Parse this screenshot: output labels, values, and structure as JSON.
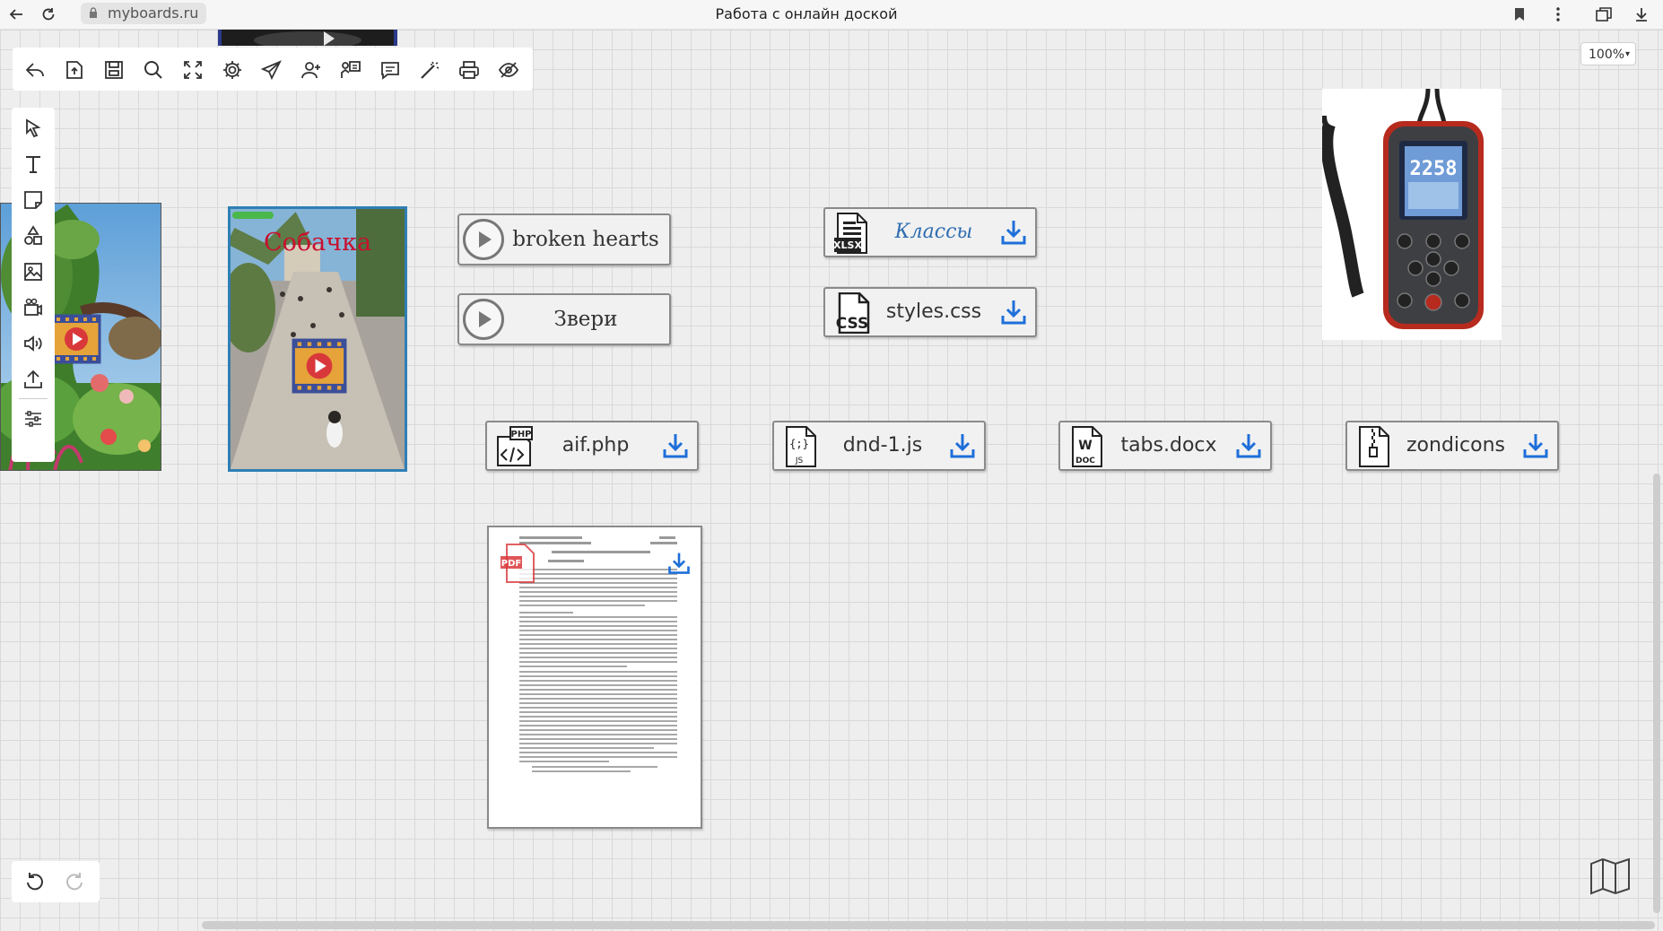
{
  "browser": {
    "url": "myboards.ru",
    "title": "Работа с онлайн доской"
  },
  "zoom": {
    "value": "100%"
  },
  "board_items": {
    "video_label": "Собачка",
    "audios": [
      {
        "label": "broken hearts"
      },
      {
        "label": "Звери"
      }
    ],
    "files": [
      {
        "label": "Классы",
        "icon": "xlsx-file-icon",
        "badge": "XLSX"
      },
      {
        "label": "styles.css",
        "icon": "css-file-icon",
        "badge": "CSS"
      },
      {
        "label": "aif.php",
        "icon": "php-file-icon",
        "badge": "PHP"
      },
      {
        "label": "dnd-1.js",
        "icon": "js-file-icon",
        "badge": "JS",
        "glyph": "{;}"
      },
      {
        "label": "tabs.docx",
        "icon": "doc-file-icon",
        "badge": "DOC",
        "glyph": "W"
      },
      {
        "label": "zondicons",
        "icon": "zip-file-icon"
      }
    ],
    "device_screen_value": "2258",
    "pdf_badge": "PDF"
  },
  "colors": {
    "download_blue": "#1e6fd9",
    "video_label_red": "#c8102e",
    "film_orange": "#e5a33a",
    "selection_green": "#4ab84a"
  }
}
